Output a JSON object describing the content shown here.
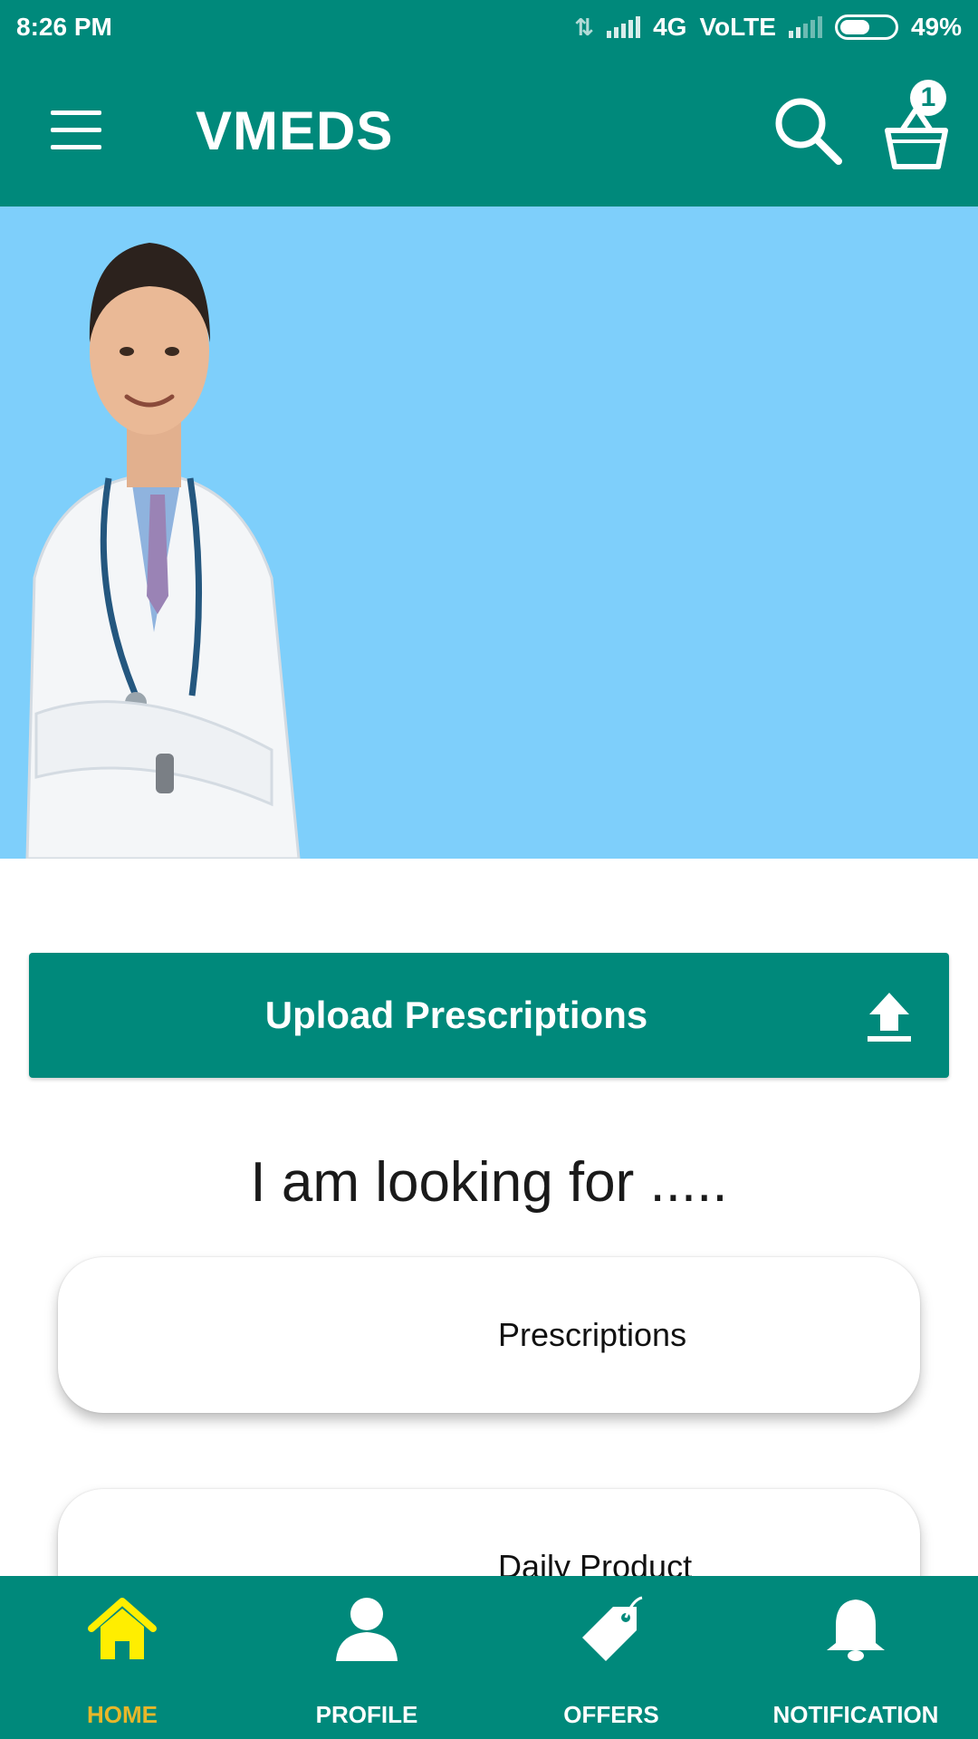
{
  "status_bar": {
    "time": "8:26 PM",
    "network": "4G",
    "volte": "VoLTE",
    "battery": "49%",
    "battery_level": 0.49
  },
  "app_bar": {
    "title": "VMEDS",
    "menu_icon": "hamburger-menu-icon",
    "search_icon": "search-icon",
    "cart_icon": "shopping-basket-icon",
    "cart_count": "1"
  },
  "hero": {
    "image": "doctor-banner-image"
  },
  "upload": {
    "label": "Upload Prescriptions",
    "icon": "upload-icon"
  },
  "section": {
    "heading": "I am looking for ....."
  },
  "categories": [
    {
      "label": "Prescriptions"
    },
    {
      "label": "Daily Product"
    }
  ],
  "bottom_nav": {
    "items": [
      {
        "label": "HOME",
        "icon": "home-icon",
        "active": true
      },
      {
        "label": "PROFILE",
        "icon": "person-icon",
        "active": false
      },
      {
        "label": "OFFERS",
        "icon": "tag-icon",
        "active": false
      },
      {
        "label": "NOTIFICATION",
        "icon": "bell-icon",
        "active": false
      }
    ]
  },
  "colors": {
    "primary": "#00897b",
    "hero_background": "#7ecffb",
    "active_nav": "#e7b72a",
    "active_icon": "#ffee00"
  }
}
